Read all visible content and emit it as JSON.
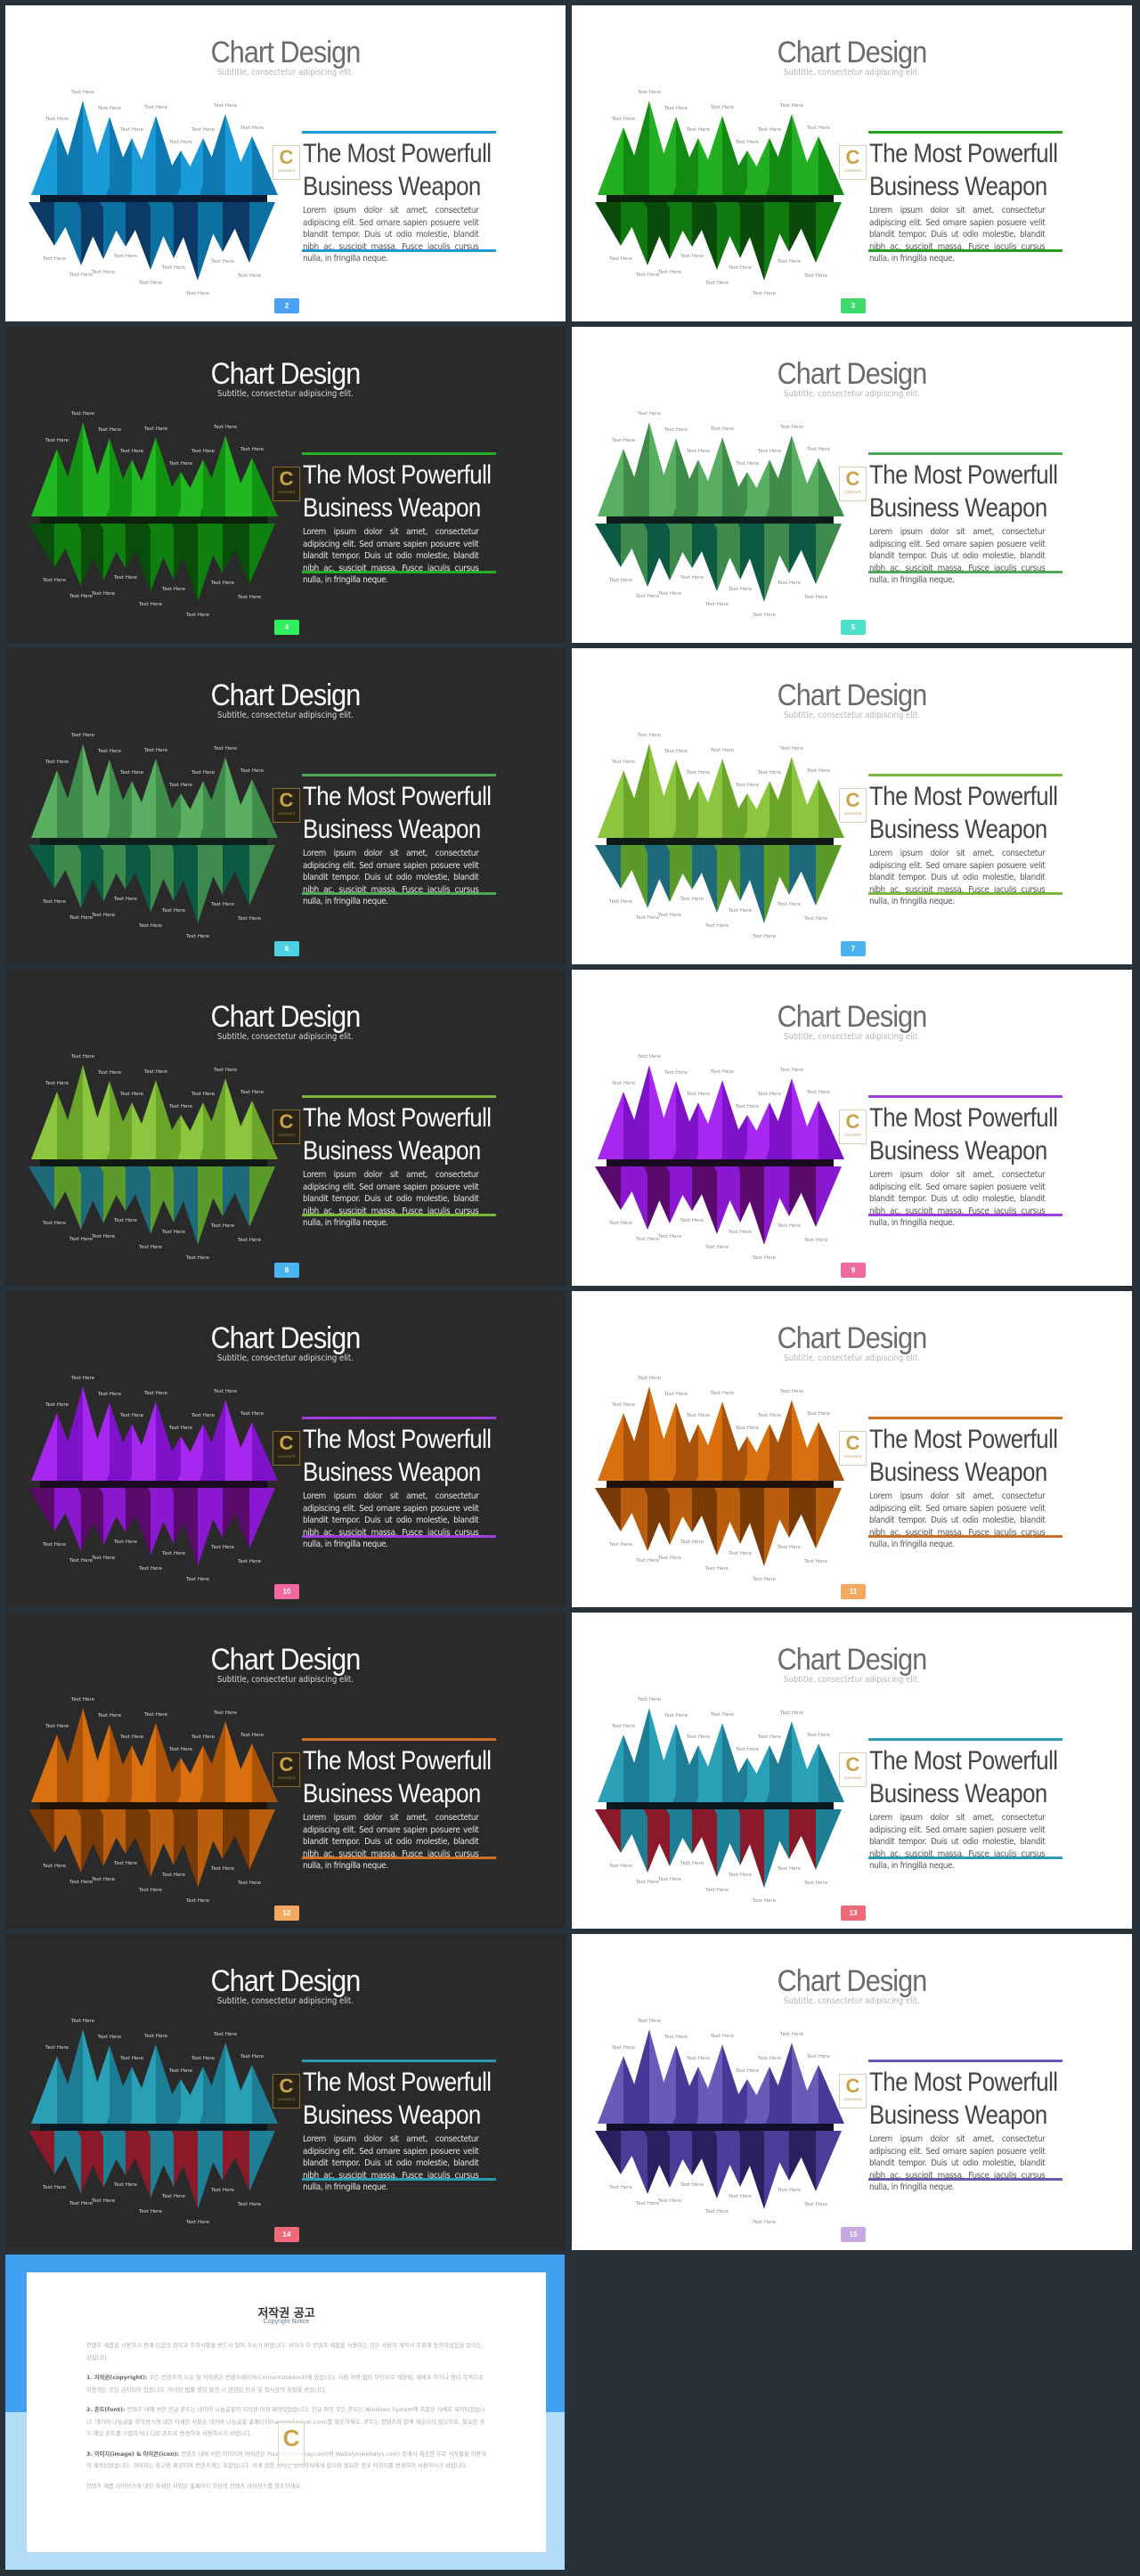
{
  "slide_common": {
    "title": "Chart Design",
    "subtitle": "Subtitle, consectetur adipiscing elit.",
    "heading_line1": "The Most Powerfull",
    "heading_line2": "Business Weapon",
    "body": "Lorem ipsum dolor sit amet, consectetur adipiscing elit. Sed ornare sapien posuere velit blandit tempor. Duis ut odio molestie, blandit nibh ac, suscipit massa. Fusce iaculis cursus nulla, in fringilla neque.",
    "labels_top": [
      "Text Here",
      "Text Here",
      "Text Here",
      "Text Here",
      "Text Here",
      "Text Here",
      "Text Here",
      "Text Here",
      "Text Here"
    ],
    "labels_bottom": [
      "Text Here",
      "Text Here",
      "Text Here",
      "Text Here",
      "Text Here",
      "Text Here",
      "Text Here",
      "Text Here",
      "Text Here"
    ],
    "logo": {
      "letter": "C",
      "text": "CONTENTS"
    }
  },
  "slides": [
    {
      "page": "2",
      "theme": "light",
      "colors": {
        "up_a": "#1a9ad6",
        "up_b": "#0d79b0",
        "down_a": "#0b6fa0",
        "down_b": "#0c3a66",
        "bar": "#0a1a30",
        "accent": "#1a9ad6",
        "badge": "#4aa3f0"
      }
    },
    {
      "page": "3",
      "theme": "light",
      "colors": {
        "up_a": "#22b022",
        "up_b": "#138a13",
        "down_a": "#107a10",
        "down_b": "#0a4a0a",
        "bar": "#0a220a",
        "accent": "#22a022",
        "badge": "#3ddc6a"
      }
    },
    {
      "page": "4",
      "theme": "dark",
      "colors": {
        "up_a": "#22b822",
        "up_b": "#129212",
        "down_a": "#0f7f0f",
        "down_b": "#0a4d0a",
        "bar": "#0c200c",
        "accent": "#22b022",
        "badge": "#2ef060"
      }
    },
    {
      "page": "5",
      "theme": "light",
      "colors": {
        "up_a": "#5aae62",
        "up_b": "#3f8c4a",
        "down_a": "#3d8a4c",
        "down_b": "#0d5a44",
        "bar": "#0e1e1a",
        "accent": "#4caa56",
        "badge": "#4de0c8"
      }
    },
    {
      "page": "6",
      "theme": "dark",
      "colors": {
        "up_a": "#5aae62",
        "up_b": "#3f8c4a",
        "down_a": "#3d8a4c",
        "down_b": "#0d5a44",
        "bar": "#0e1e1a",
        "accent": "#4caa56",
        "badge": "#4dd0e0"
      }
    },
    {
      "page": "7",
      "theme": "light",
      "colors": {
        "up_a": "#8cc63f",
        "up_b": "#6aa52a",
        "down_a": "#5a9a2a",
        "down_b": "#1e6a7a",
        "bar": "#101a14",
        "accent": "#7ab83a",
        "badge": "#4ab4f0"
      }
    },
    {
      "page": "8",
      "theme": "dark",
      "colors": {
        "up_a": "#8cc63f",
        "up_b": "#6aa52a",
        "down_a": "#5a9a2a",
        "down_b": "#1e6a7a",
        "bar": "#101a14",
        "accent": "#7ab83a",
        "badge": "#4ab4f0"
      }
    },
    {
      "page": "9",
      "theme": "light",
      "colors": {
        "up_a": "#a628f0",
        "up_b": "#7e12c8",
        "down_a": "#8a18d0",
        "down_b": "#5a0a6a",
        "bar": "#1a0a22",
        "accent": "#a03ee0",
        "badge": "#f06aa0"
      }
    },
    {
      "page": "10",
      "theme": "dark",
      "colors": {
        "up_a": "#a628f0",
        "up_b": "#7e12c8",
        "down_a": "#8a18d0",
        "down_b": "#5a0a6a",
        "bar": "#1a0a22",
        "accent": "#a03ee0",
        "badge": "#f06aa0"
      }
    },
    {
      "page": "11",
      "theme": "light",
      "colors": {
        "up_a": "#d8700f",
        "up_b": "#a8520a",
        "down_a": "#b85e0c",
        "down_b": "#7a3a06",
        "bar": "#201208",
        "accent": "#d07020",
        "badge": "#f5a860"
      }
    },
    {
      "page": "12",
      "theme": "dark",
      "colors": {
        "up_a": "#d8700f",
        "up_b": "#a8520a",
        "down_a": "#b85e0c",
        "down_b": "#7a3a06",
        "bar": "#201208",
        "accent": "#d07020",
        "badge": "#f5a860"
      }
    },
    {
      "page": "13",
      "theme": "light",
      "colors": {
        "up_a": "#2aa0b6",
        "up_b": "#1c7d94",
        "down_a": "#1e7f94",
        "down_b": "#8a1a2a",
        "bar": "#0a1a20",
        "accent": "#2a9bb0",
        "badge": "#f06a7a"
      }
    },
    {
      "page": "14",
      "theme": "dark",
      "colors": {
        "up_a": "#2aa0b6",
        "up_b": "#1c7d94",
        "down_a": "#1e7f94",
        "down_b": "#8a1a2a",
        "bar": "#0a1a20",
        "accent": "#2a9bb0",
        "badge": "#f06a7a"
      }
    },
    {
      "page": "15",
      "theme": "light",
      "colors": {
        "up_a": "#6a5ab8",
        "up_b": "#473a96",
        "down_a": "#4a3d98",
        "down_b": "#2a2060",
        "bar": "#10102a",
        "accent": "#6a5ab8",
        "badge": "#c8a8e0"
      }
    }
  ],
  "copyright": {
    "title": "저작권 공고",
    "subtitle": "Copyright Notice",
    "colors": {
      "top": "#42a0f0",
      "bottom": "#b2dcf8"
    },
    "intro": "컨텐츠 제품을 사용하기 전에 다음의 항목과 주의사항을 반드시 읽어 주시기 바랍니다. 귀하가 이 컨텐츠 제품을 사용하는 것은 사용자 계약서 조항에 동의하셨음을 알리는 것입니다.",
    "items": [
      {
        "label": "1. 저작권(copyright):",
        "text": "모든 컨텐츠의 소유 및 저작권은 컨텐츠메이커(Contentstokeout)에 있습니다. 사전 허락 없이 무단으로 재판매, 재배포 하거나 영리 목적으로 이용하는 것은 금지되어 있습니다. 이러한 법률 행위 발견 시 관련된 민사 및 형사상의 처벌을 받습니다."
      },
      {
        "label": "2. 폰트(font):",
        "text": "컨텐츠 내에 쓰인 한글 폰트는 네이버 나눔글꼴의 저작권 아래 제작되었습니다. 한글 외의 모든 폰트는 Windows System에 포함된 서체로 제작되었습니다. 네이버 나눔글꼴 라이선스에 대한 자세한 사항은 네이버 나눔글꼴 홈페이지(hangeul.naver.com)를 참조하세요. 폰트는 컨텐츠와 함께 제공되지 않으므로, 필요한 경우 해당 폰트를 구입하거나 다른 폰트로 변경하여 사용하시기 바랍니다."
      },
      {
        "label": "3. 이미지(image) & 아이콘(icon):",
        "text": "컨텐츠 내에 쓰인 이미지와 아이콘은 Pixabay(pixabay.com)와 Webalys(webalys.com) 등에서 제공한 무료 저작물을 이용하여 제작되었습니다. 이미지는 참고용 제공되며 컨텐츠에는 포함됩니다. 이에 관한 권리는 원저작자에게 있으며 필요한 경우 이미지를 변경하여 사용하시기 바랍니다."
      }
    ],
    "outro": "컨텐츠 제품 라이선스에 대한 자세한 사항은 홈페이지 하단의 컨텐츠 라이선스를 참조하세요."
  }
}
